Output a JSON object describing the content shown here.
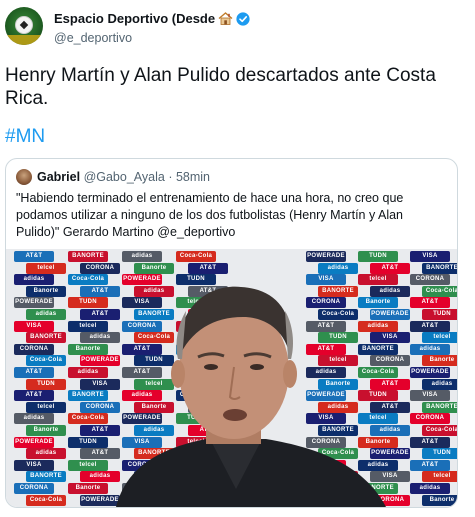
{
  "tweet": {
    "author_name": "Espacio Deportivo (Desde",
    "author_emoji_icon": "house-icon",
    "verified_icon": "verified-badge-icon",
    "author_handle": "@e_deportivo",
    "text": "Henry Martín y Alan Pulido descartados ante Costa Rica.",
    "hashtag": "#MN"
  },
  "quote": {
    "author_name": "Gabriel",
    "author_handle": "@Gabo_Ayala",
    "separator": "·",
    "time": "58min",
    "text": "\"Habiendo terminado el entrenamiento de hace una hora, no creo que podamos utilizar a ninguno de los dos futbolistas (Henry Martín y Alan Pulido)\" Gerardo Martino  @e_deportivo",
    "sponsor_labels": [
      "AT&T",
      "BANORTE",
      "adidas",
      "Coca-Cola",
      "POWERADE",
      "TUDN",
      "VISA",
      "telcel",
      "CORONA",
      "Banorte",
      "AT&T",
      "adidas"
    ]
  },
  "colors": {
    "link": "#1d9bf0",
    "verified": "#1d9bf0",
    "muted_text": "#536471",
    "border": "#cfd9de"
  }
}
